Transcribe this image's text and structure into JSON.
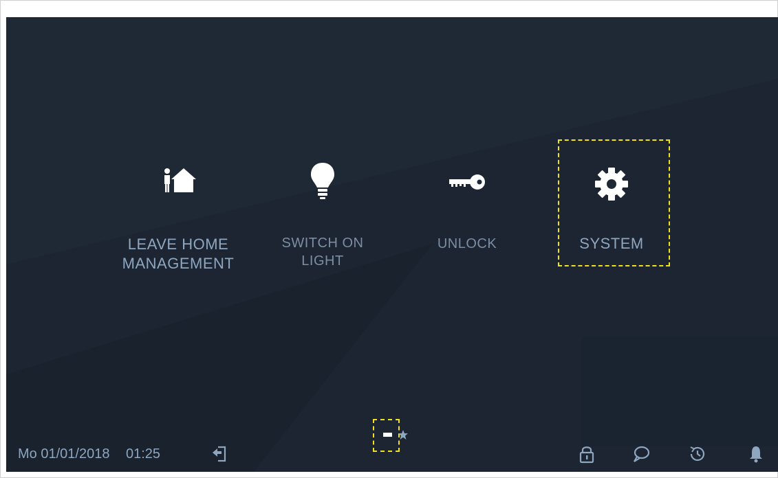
{
  "tiles": [
    {
      "label_line1": "LEAVE HOME",
      "label_line2": "MANAGEMENT",
      "icon": "leave-home-icon"
    },
    {
      "label_line1": "SWITCH ON",
      "label_line2": "LIGHT",
      "icon": "light-bulb-icon"
    },
    {
      "label_line1": "UNLOCK",
      "label_line2": "",
      "icon": "key-icon"
    },
    {
      "label_line1": "SYSTEM",
      "label_line2": "",
      "icon": "gear-icon"
    }
  ],
  "statusbar": {
    "date": "Mo 01/01/2018",
    "time": "01:25",
    "icons": [
      "exit-icon",
      "lock-icon",
      "message-icon",
      "history-icon",
      "bell-icon"
    ]
  },
  "pager": {
    "current_page_indicator": "page-dash-indicator",
    "favorites_icon": "star-icon"
  },
  "colors": {
    "background": "#1f2936",
    "label": "#8ea6c0",
    "icon": "#ffffff",
    "highlight": "#f2e21a"
  }
}
